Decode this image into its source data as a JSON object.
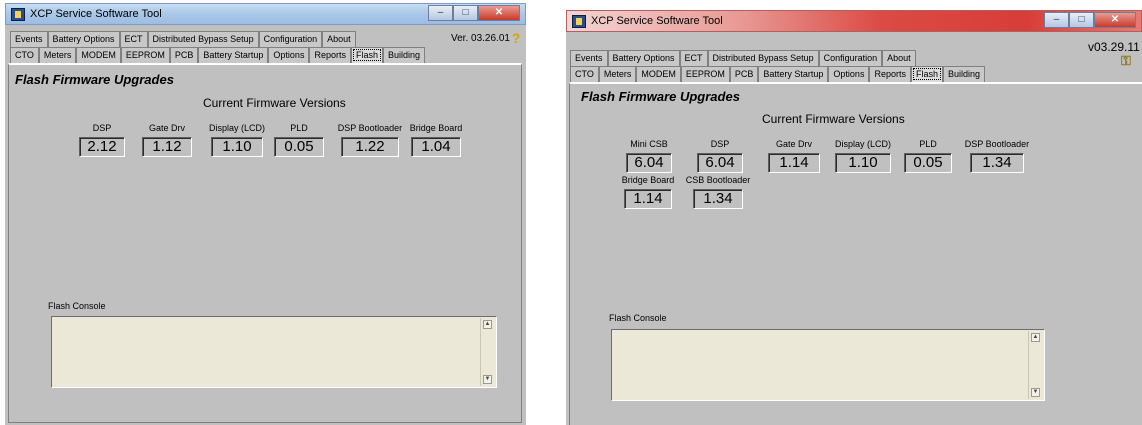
{
  "left": {
    "title": "XCP Service Software Tool",
    "version": "Ver. 03.26.01",
    "tabs_row1": [
      "Events",
      "Battery Options",
      "ECT",
      "Distributed Bypass Setup",
      "Configuration",
      "About"
    ],
    "tabs_row2": [
      "CTO",
      "Meters",
      "MODEM",
      "EEPROM",
      "PCB",
      "Battery Startup",
      "Options",
      "Reports",
      "Flash",
      "Building"
    ],
    "heading": "Flash Firmware Upgrades",
    "subheading": "Current Firmware Versions",
    "firmware": [
      {
        "label": "DSP",
        "value": "2.12"
      },
      {
        "label": "Gate Drv",
        "value": "1.12"
      },
      {
        "label": "Display (LCD)",
        "value": "1.10"
      },
      {
        "label": "PLD",
        "value": "0.05"
      },
      {
        "label": "DSP Bootloader",
        "value": "1.22"
      },
      {
        "label": "Bridge Board",
        "value": "1.04"
      }
    ],
    "console_label": "Flash Console"
  },
  "right": {
    "title": "XCP Service Software Tool",
    "version": "v03.29.11",
    "tabs_row1": [
      "Events",
      "Battery Options",
      "ECT",
      "Distributed Bypass Setup",
      "Configuration",
      "About"
    ],
    "tabs_row2": [
      "CTO",
      "Meters",
      "MODEM",
      "EEPROM",
      "PCB",
      "Battery Startup",
      "Options",
      "Reports",
      "Flash",
      "Building"
    ],
    "heading": "Flash Firmware Upgrades",
    "subheading": "Current Firmware Versions",
    "firmware": [
      {
        "label": "Mini CSB",
        "value": "6.04"
      },
      {
        "label": "DSP",
        "value": "6.04"
      },
      {
        "label": "Gate Drv",
        "value": "1.14"
      },
      {
        "label": "Display (LCD)",
        "value": "1.10"
      },
      {
        "label": "PLD",
        "value": "0.05"
      },
      {
        "label": "DSP Bootloader",
        "value": "1.34"
      },
      {
        "label": "Bridge Board",
        "value": "1.14"
      },
      {
        "label": "CSB Bootloader",
        "value": "1.34"
      }
    ],
    "console_label": "Flash Console"
  },
  "icons": {
    "help": "help-icon",
    "key": "key-icon",
    "app": "app-icon"
  }
}
